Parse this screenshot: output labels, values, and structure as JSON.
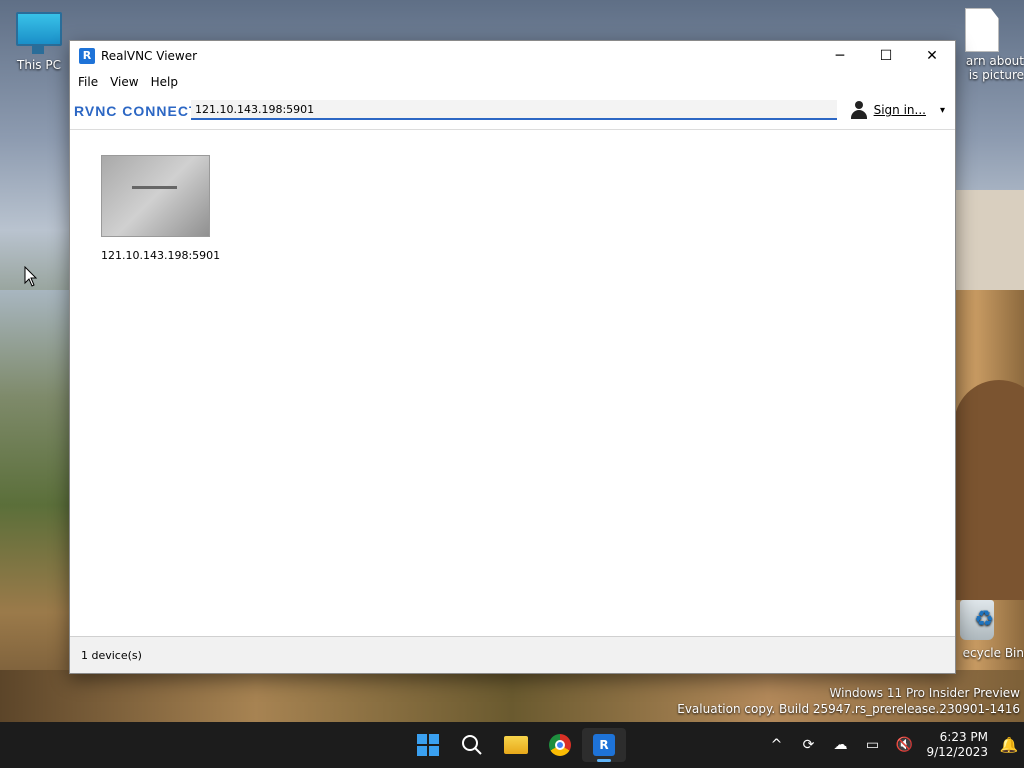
{
  "desktop": {
    "icons": [
      {
        "label": "This PC"
      },
      {
        "label": "arn about\nis picture"
      },
      {
        "label": "ecycle Bin"
      }
    ],
    "watermark": {
      "line1": "Windows 11 Pro Insider Preview",
      "line2": "Evaluation copy. Build 25947.rs_prerelease.230901-1416"
    }
  },
  "window": {
    "title": "RealVNC Viewer",
    "app_icon_glyph": "R",
    "controls": {
      "minimize": "─",
      "maximize": "☐",
      "close": "✕"
    },
    "menu": [
      "File",
      "View",
      "Help"
    ],
    "brand": "RVNC CONNECT",
    "address": {
      "value": "121.10.143.198:5901"
    },
    "signin": {
      "label": "Sign in...",
      "caret": "▾"
    },
    "devices": [
      {
        "label": "121.10.143.198:5901"
      }
    ],
    "status": "1 device(s)"
  },
  "taskbar": {
    "apps": [
      {
        "name": "start-button"
      },
      {
        "name": "search-button",
        "glyph": "⌕"
      },
      {
        "name": "file-explorer-button"
      },
      {
        "name": "chrome-button"
      },
      {
        "name": "realvnc-button",
        "glyph": "R",
        "active": true
      }
    ],
    "tray": {
      "chevron": "^",
      "time": "6:23 PM",
      "date": "9/12/2023"
    }
  }
}
